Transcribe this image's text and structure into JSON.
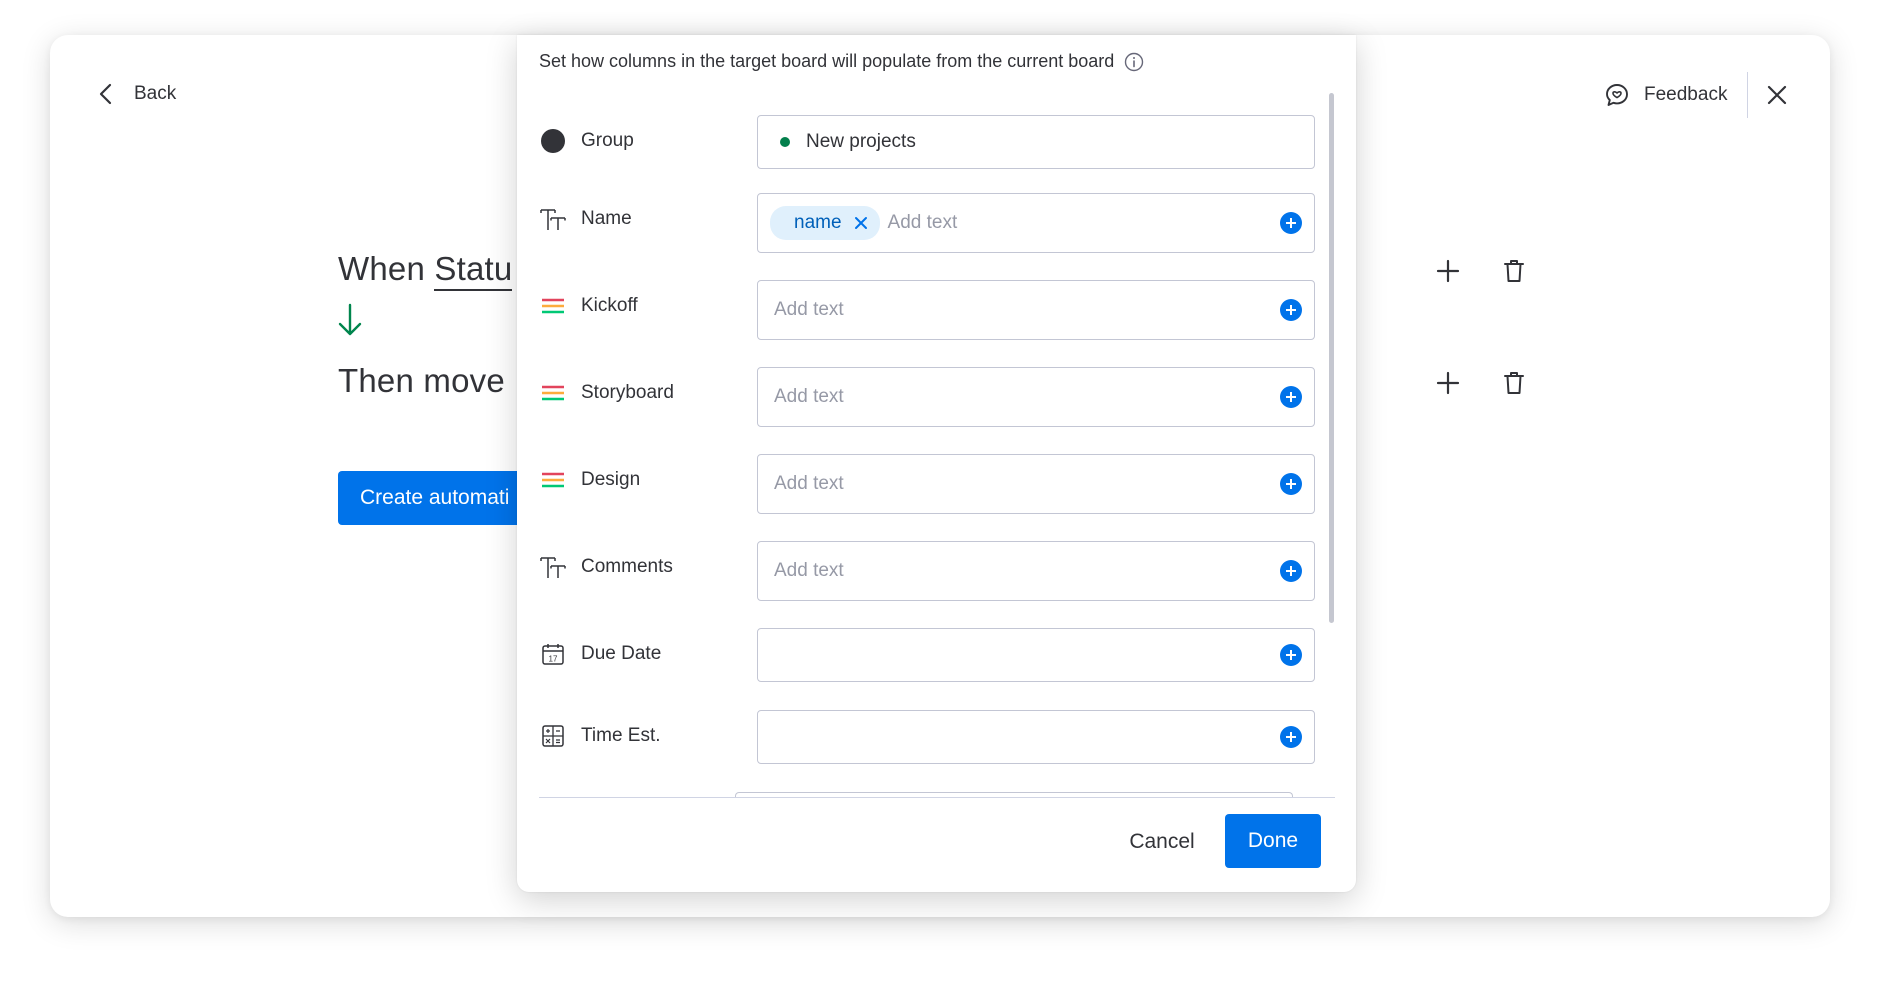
{
  "header": {
    "back_label": "Back",
    "feedback_label": "Feedback"
  },
  "recipe": {
    "when_prefix": "When",
    "when_trigger": "Statu",
    "then_text": "Then move",
    "create_button": "Create automati"
  },
  "modal": {
    "description": "Set how columns in the target board will populate from the current board",
    "fields": [
      {
        "label": "Group",
        "icon": "group-dot-icon",
        "value": "New projects",
        "placeholder": ""
      },
      {
        "label": "Name",
        "icon": "text-type-icon",
        "chip": "name",
        "placeholder": "Add text"
      },
      {
        "label": "Kickoff",
        "icon": "status-lines-icon",
        "placeholder": "Add text"
      },
      {
        "label": "Storyboard",
        "icon": "status-lines-icon",
        "placeholder": "Add text"
      },
      {
        "label": "Design",
        "icon": "status-lines-icon",
        "placeholder": "Add text"
      },
      {
        "label": "Comments",
        "icon": "text-type-icon",
        "placeholder": "Add text"
      },
      {
        "label": "Due Date",
        "icon": "calendar-icon",
        "placeholder": ""
      },
      {
        "label": "Time Est.",
        "icon": "formula-icon",
        "placeholder": ""
      }
    ],
    "cancel_label": "Cancel",
    "done_label": "Done"
  },
  "colors": {
    "primary": "#0073ea",
    "group_dot": "#037f4c",
    "status_line_1": "#e2445c",
    "status_line_2": "#fdab3d",
    "status_line_3": "#00c875",
    "arrow_green": "#00854d"
  }
}
